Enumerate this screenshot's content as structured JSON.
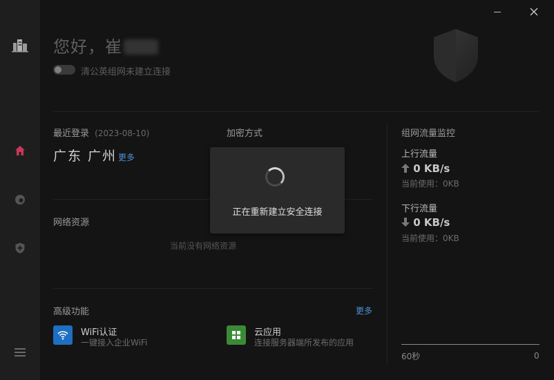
{
  "window": {
    "minimize_icon": "minimize-icon",
    "close_icon": "close-icon"
  },
  "sidebar": {
    "logo_icon": "buildings-logo-icon",
    "items": [
      {
        "id": "home",
        "icon": "home-icon",
        "active": true
      },
      {
        "id": "network",
        "icon": "globe-icon",
        "active": false
      },
      {
        "id": "security",
        "icon": "shield-plus-icon",
        "active": false
      }
    ],
    "menu_icon": "menu-icon"
  },
  "header": {
    "greeting": "您好，崔",
    "toggle_label": "清公英组网未建立连接",
    "toggle_on": false
  },
  "last_login": {
    "title": "最近登录",
    "date": "(2023-08-10)",
    "location": "广东 广州",
    "more": "更多"
  },
  "encryption": {
    "title": "加密方式"
  },
  "network_resources": {
    "title": "网络资源",
    "empty_text": "当前没有网络资源"
  },
  "advanced": {
    "title": "高级功能",
    "more": "更多",
    "features": [
      {
        "title": "WiFi认证",
        "subtitle": "一键接入企业WiFi",
        "icon": "wifi-icon",
        "color": "#1e6fc1"
      },
      {
        "title": "云应用",
        "subtitle": "连接服务器端所发布的应用",
        "icon": "grid-apps-icon",
        "color": "#3a8a35"
      }
    ]
  },
  "traffic": {
    "title": "组网流量监控",
    "upload": {
      "label": "上行流量",
      "value": "0 KB/s",
      "usage": "当前使用：0KB"
    },
    "download": {
      "label": "下行流量",
      "value": "0 KB/s",
      "usage": "当前使用：0KB"
    },
    "axis_left": "60秒",
    "axis_right": "0"
  },
  "overlay": {
    "message": "正在重新建立安全连接"
  },
  "colors": {
    "accent_active": "#c9385a",
    "link": "#4f8fd6"
  }
}
